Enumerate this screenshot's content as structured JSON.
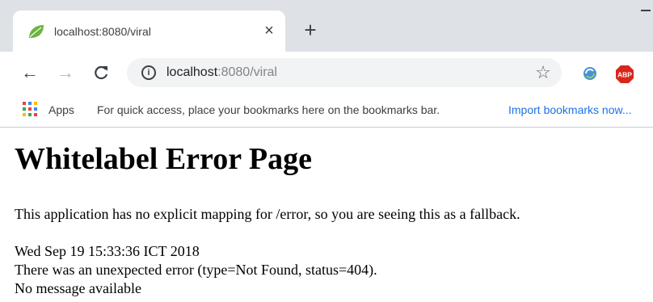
{
  "tab": {
    "title": "localhost:8080/viral",
    "close_glyph": "×",
    "favicon": "spring-leaf-icon"
  },
  "newtab_glyph": "+",
  "toolbar": {
    "back_glyph": "←",
    "forward_glyph": "→",
    "reload_glyph": "C",
    "info_glyph": "i",
    "url_host": "localhost",
    "url_rest": ":8080/viral",
    "star_glyph": "☆",
    "abp_label": "ABP"
  },
  "bookmarks": {
    "apps_label": "Apps",
    "hint": "For quick access, place your bookmarks here on the bookmarks bar.",
    "import_link": "Import bookmarks now..."
  },
  "page": {
    "heading": "Whitelabel Error Page",
    "message": "This application has no explicit mapping for /error, so you are seeing this as a fallback.",
    "timestamp": "Wed Sep 19 15:33:36 ICT 2018",
    "error": "There was an unexpected error (type=Not Found, status=404).",
    "detail": "No message available"
  },
  "colors": {
    "tabstrip": "#dee1e6",
    "omnibox": "#f1f3f4",
    "link": "#1a73e8",
    "abp_red": "#d9261c",
    "spring_green": "#6db33f"
  }
}
